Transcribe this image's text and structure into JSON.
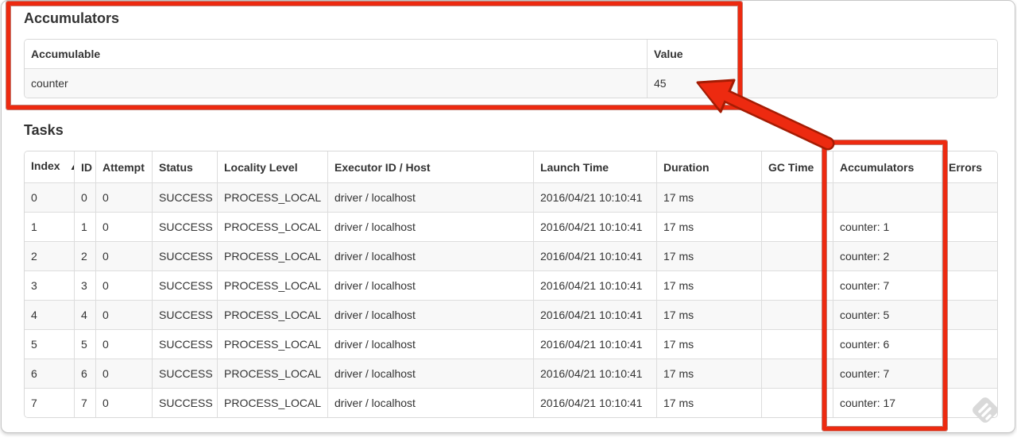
{
  "accumulators_section": {
    "title": "Accumulators",
    "headers": {
      "accumulable": "Accumulable",
      "value": "Value"
    },
    "rows": [
      {
        "accumulable": "counter",
        "value": "45"
      }
    ]
  },
  "tasks_section": {
    "title": "Tasks",
    "headers": {
      "index": "Index",
      "id": "ID",
      "attempt": "Attempt",
      "status": "Status",
      "locality_level": "Locality Level",
      "executor_id_host": "Executor ID / Host",
      "launch_time": "Launch Time",
      "duration": "Duration",
      "gc_time": "GC Time",
      "accumulators": "Accumulators",
      "errors": "Errors"
    },
    "sort": {
      "column": "Index",
      "direction": "ascending",
      "indicator": "▲"
    },
    "rows": [
      {
        "index": "0",
        "id": "0",
        "attempt": "0",
        "status": "SUCCESS",
        "locality_level": "PROCESS_LOCAL",
        "executor_id_host": "driver / localhost",
        "launch_time": "2016/04/21 10:10:41",
        "duration": "17 ms",
        "gc_time": "",
        "accumulators": "",
        "errors": ""
      },
      {
        "index": "1",
        "id": "1",
        "attempt": "0",
        "status": "SUCCESS",
        "locality_level": "PROCESS_LOCAL",
        "executor_id_host": "driver / localhost",
        "launch_time": "2016/04/21 10:10:41",
        "duration": "17 ms",
        "gc_time": "",
        "accumulators": "counter: 1",
        "errors": ""
      },
      {
        "index": "2",
        "id": "2",
        "attempt": "0",
        "status": "SUCCESS",
        "locality_level": "PROCESS_LOCAL",
        "executor_id_host": "driver / localhost",
        "launch_time": "2016/04/21 10:10:41",
        "duration": "17 ms",
        "gc_time": "",
        "accumulators": "counter: 2",
        "errors": ""
      },
      {
        "index": "3",
        "id": "3",
        "attempt": "0",
        "status": "SUCCESS",
        "locality_level": "PROCESS_LOCAL",
        "executor_id_host": "driver / localhost",
        "launch_time": "2016/04/21 10:10:41",
        "duration": "17 ms",
        "gc_time": "",
        "accumulators": "counter: 7",
        "errors": ""
      },
      {
        "index": "4",
        "id": "4",
        "attempt": "0",
        "status": "SUCCESS",
        "locality_level": "PROCESS_LOCAL",
        "executor_id_host": "driver / localhost",
        "launch_time": "2016/04/21 10:10:41",
        "duration": "17 ms",
        "gc_time": "",
        "accumulators": "counter: 5",
        "errors": ""
      },
      {
        "index": "5",
        "id": "5",
        "attempt": "0",
        "status": "SUCCESS",
        "locality_level": "PROCESS_LOCAL",
        "executor_id_host": "driver / localhost",
        "launch_time": "2016/04/21 10:10:41",
        "duration": "17 ms",
        "gc_time": "",
        "accumulators": "counter: 6",
        "errors": ""
      },
      {
        "index": "6",
        "id": "6",
        "attempt": "0",
        "status": "SUCCESS",
        "locality_level": "PROCESS_LOCAL",
        "executor_id_host": "driver / localhost",
        "launch_time": "2016/04/21 10:10:41",
        "duration": "17 ms",
        "gc_time": "",
        "accumulators": "counter: 7",
        "errors": ""
      },
      {
        "index": "7",
        "id": "7",
        "attempt": "0",
        "status": "SUCCESS",
        "locality_level": "PROCESS_LOCAL",
        "executor_id_host": "driver / localhost",
        "launch_time": "2016/04/21 10:10:41",
        "duration": "17 ms",
        "gc_time": "",
        "accumulators": "counter: 17",
        "errors": ""
      }
    ]
  },
  "annotations": {
    "highlight_color": "#ed2a10",
    "highlight_outline_color": "#a51c04",
    "watermark_icon": "skitch-logo",
    "watermark_color": "#d9d9d9"
  }
}
